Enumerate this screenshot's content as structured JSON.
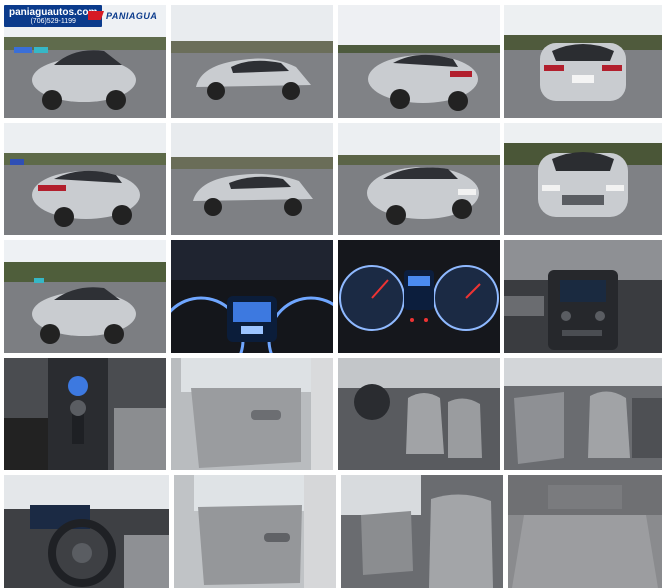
{
  "dealer": {
    "website": "paniaguautos.com",
    "phone": "(706)529-1199",
    "brand_name": "PANIAGUA"
  },
  "photos": [
    {
      "subject": "front-left exterior"
    },
    {
      "subject": "left side exterior"
    },
    {
      "subject": "rear-left exterior"
    },
    {
      "subject": "rear exterior"
    },
    {
      "subject": "rear-left exterior angled"
    },
    {
      "subject": "left side exterior profile"
    },
    {
      "subject": "front-right exterior"
    },
    {
      "subject": "front exterior"
    },
    {
      "subject": "front-left exterior wide"
    },
    {
      "subject": "instrument cluster"
    },
    {
      "subject": "gauges closeup"
    },
    {
      "subject": "center console radio"
    },
    {
      "subject": "gear shifter console"
    },
    {
      "subject": "rear door interior"
    },
    {
      "subject": "front seats driver side"
    },
    {
      "subject": "front seats passenger side"
    },
    {
      "subject": "steering wheel dashboard"
    },
    {
      "subject": "rear door open"
    },
    {
      "subject": "rear seats"
    },
    {
      "subject": "trunk"
    }
  ],
  "colors": {
    "car_silver": "#c9ccd0",
    "asphalt": "#7d7f83",
    "sky": "#e9ecef",
    "interior_gray": "#9a9c9f",
    "dash_dark": "#2a2c30",
    "gauge_blue": "#6fa6ff"
  }
}
